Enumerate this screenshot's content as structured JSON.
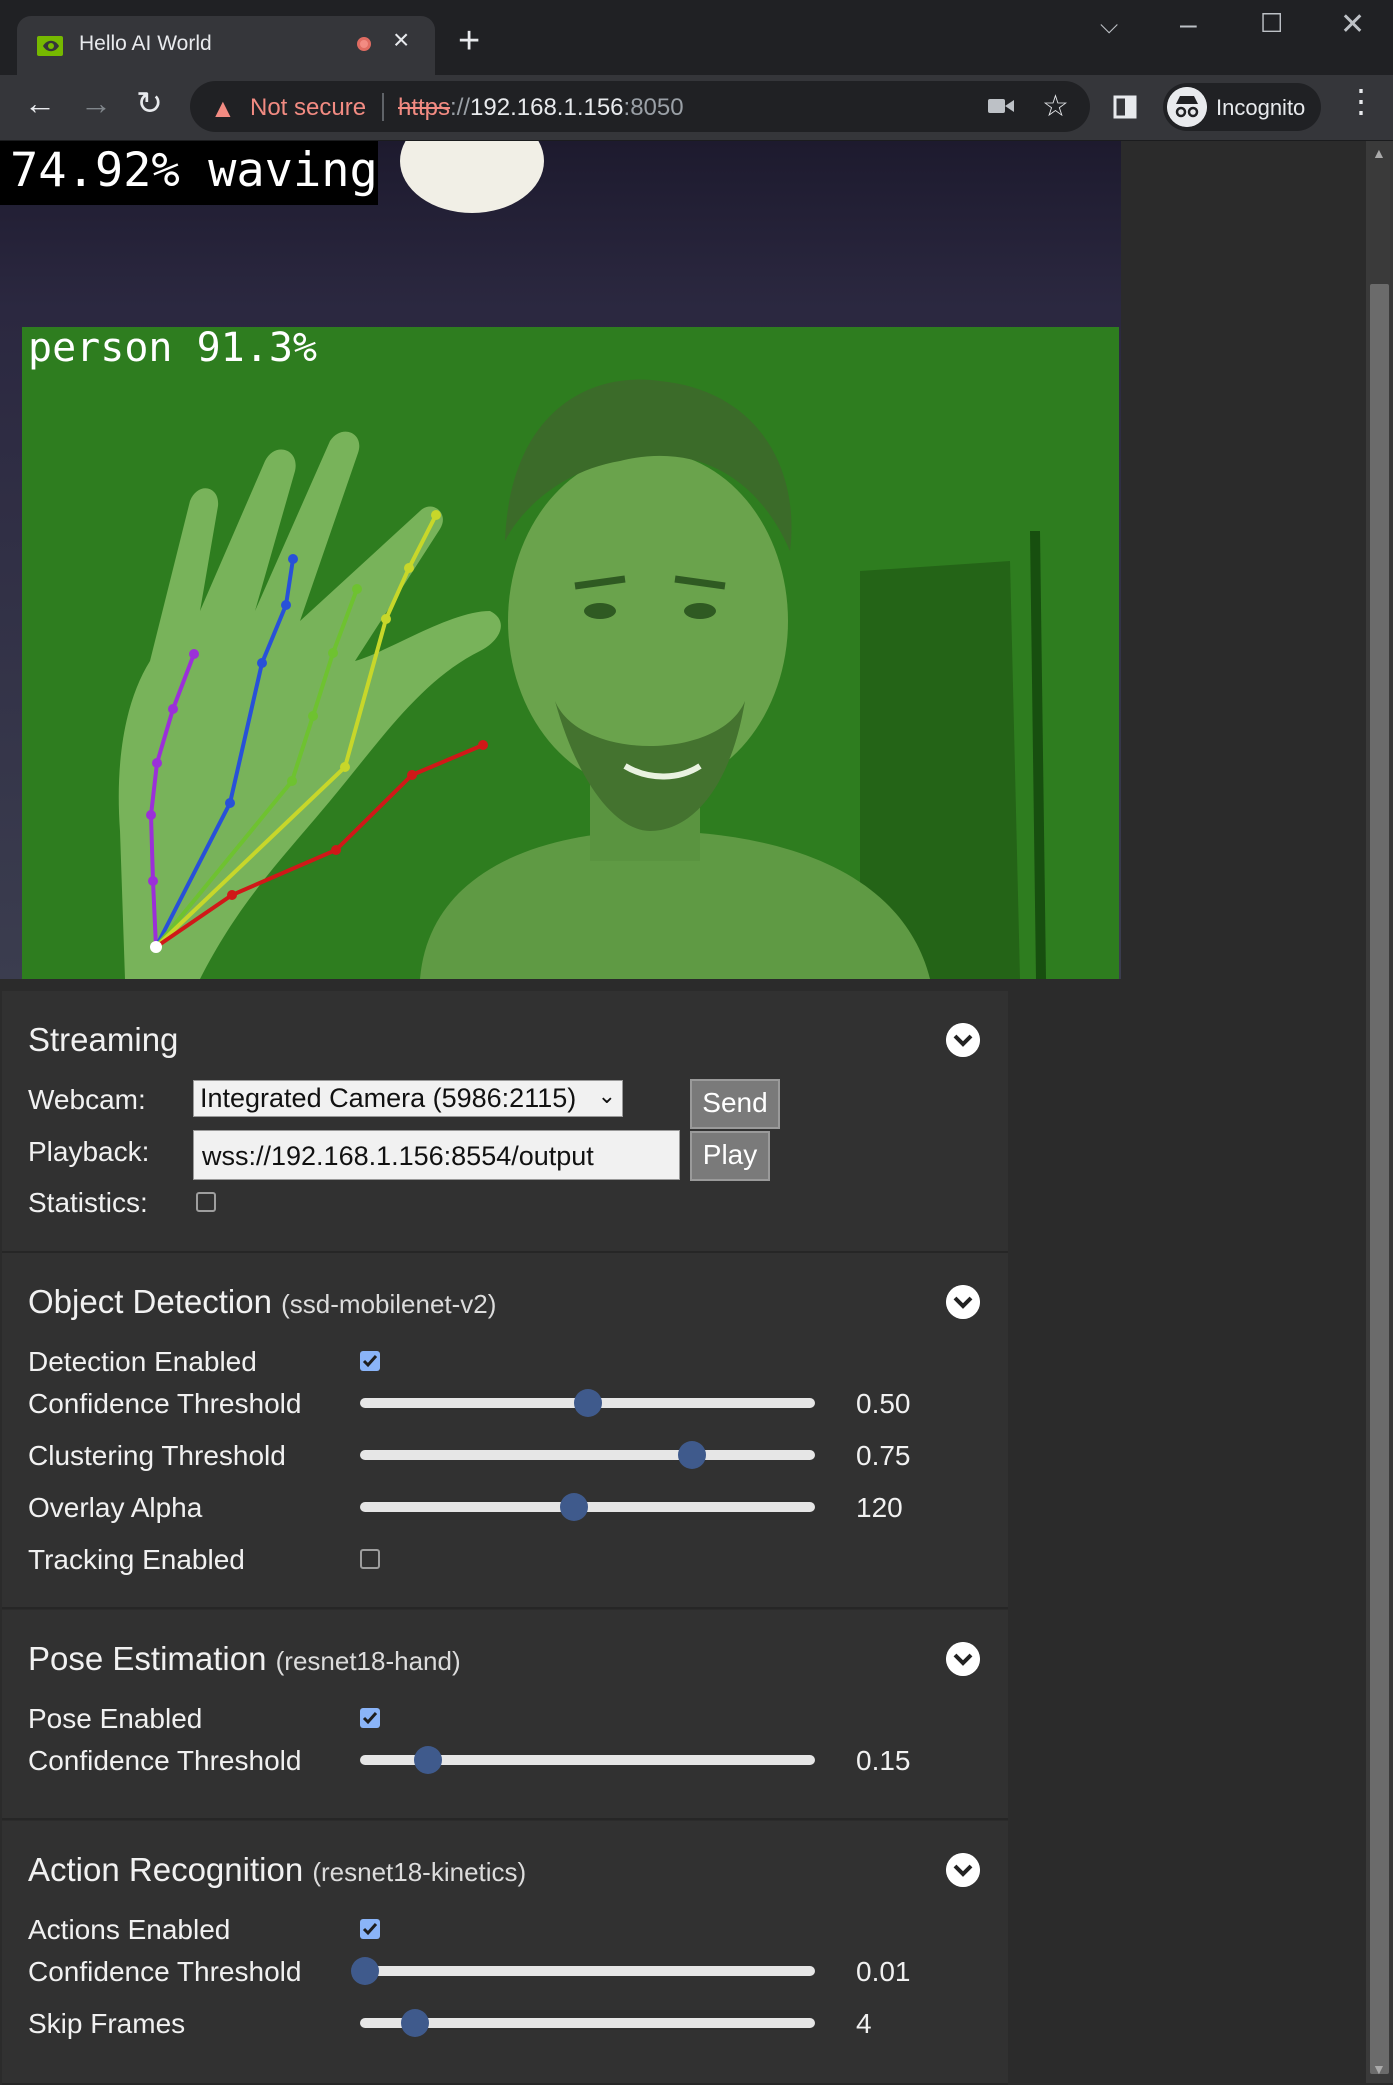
{
  "browser": {
    "tab_title": "Hello AI World",
    "tab_close": "×",
    "new_tab": "+",
    "security_label": "Not secure",
    "url_scheme": "https",
    "url_sep": "://",
    "url_host": "192.168.1.156",
    "url_port": ":8050",
    "profile_label": "Incognito"
  },
  "video": {
    "action_label": "74.92% waving",
    "detection_label": "person 91.3%"
  },
  "streaming": {
    "title": "Streaming",
    "webcam_label": "Webcam:",
    "webcam_value": "Integrated Camera (5986:2115)",
    "send_label": "Send",
    "playback_label": "Playback:",
    "playback_value": "wss://192.168.1.156:8554/output",
    "play_label": "Play",
    "statistics_label": "Statistics:",
    "statistics_checked": false
  },
  "detection": {
    "title": "Object Detection",
    "model": "(ssd-mobilenet-v2)",
    "enabled_label": "Detection Enabled",
    "enabled": true,
    "confidence_label": "Confidence Threshold",
    "confidence_value": "0.50",
    "confidence_level": 0.5,
    "clustering_label": "Clustering Threshold",
    "clustering_value": "0.75",
    "clustering_level": 0.73,
    "alpha_label": "Overlay Alpha",
    "alpha_value": "120",
    "alpha_level": 0.47,
    "tracking_label": "Tracking Enabled",
    "tracking": false
  },
  "pose": {
    "title": "Pose Estimation",
    "model": "(resnet18-hand)",
    "enabled_label": "Pose Enabled",
    "enabled": true,
    "confidence_label": "Confidence Threshold",
    "confidence_value": "0.15",
    "confidence_level": 0.15
  },
  "action": {
    "title": "Action Recognition",
    "model": "(resnet18-kinetics)",
    "enabled_label": "Actions Enabled",
    "enabled": true,
    "confidence_label": "Confidence Threshold",
    "confidence_value": "0.01",
    "confidence_level": 0.01,
    "skip_label": "Skip Frames",
    "skip_value": "4",
    "skip_level": 0.12
  },
  "colors": {
    "card_bg": "#313131",
    "slider_thumb": "#3f5a8c",
    "checkbox_on": "#8ab4f8",
    "detection_overlay": "#2e7d1f"
  }
}
